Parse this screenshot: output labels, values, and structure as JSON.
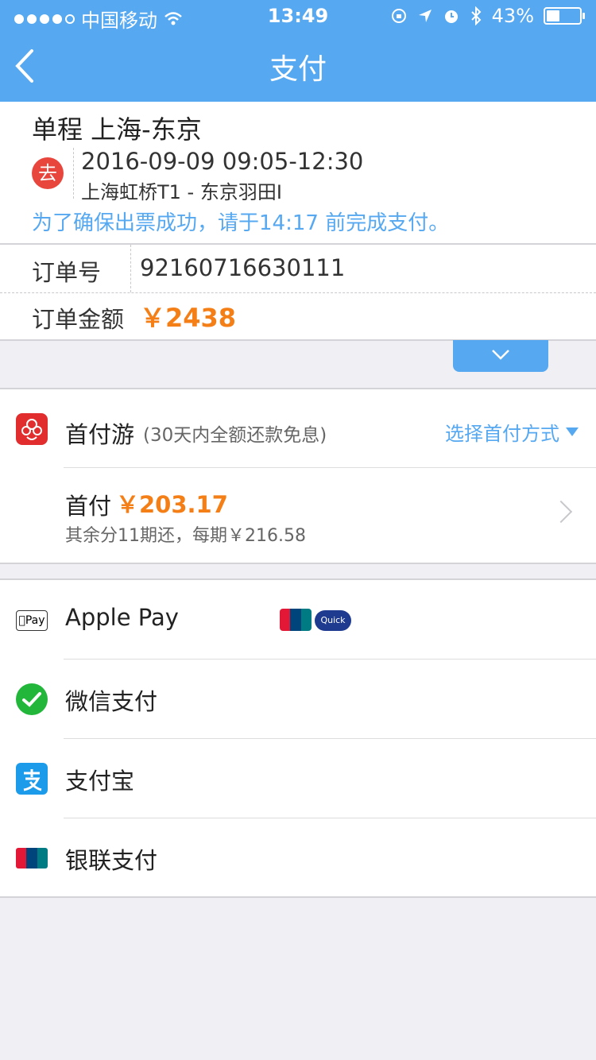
{
  "statusbar": {
    "carrier": "中国移动",
    "time": "13:49",
    "battery": "43%"
  },
  "nav": {
    "title": "支付"
  },
  "trip": {
    "title": "单程 上海-东京",
    "badge": "去",
    "datetime": "2016-09-09 09:05-12:30",
    "airports": "上海虹桥T1 - 东京羽田I",
    "notice": "为了确保出票成功，请于14:17 前完成支付。"
  },
  "order": {
    "number_label": "订单号",
    "number": "92160716630111",
    "amount_label": "订单金额",
    "amount": "￥2438"
  },
  "installment": {
    "name": "首付游",
    "desc": "(30天内全额还款免息)",
    "select_label": "选择首付方式",
    "first_label": "首付",
    "first_amount": "￥203.17",
    "rest": "其余分11期还，每期￥216.58"
  },
  "payment_methods": [
    {
      "label": "Apple Pay",
      "icon": "apple-pay-icon"
    },
    {
      "label": "微信支付",
      "icon": "wechat-pay-icon"
    },
    {
      "label": "支付宝",
      "icon": "alipay-icon"
    },
    {
      "label": "银联支付",
      "icon": "unionpay-icon"
    }
  ],
  "applepay_extra": {
    "apple_icon_text": "Pay",
    "quickpass_text": "Quick"
  },
  "colors": {
    "primary": "#56a8f1",
    "price": "#f57f17",
    "badge": "#e8463d"
  }
}
